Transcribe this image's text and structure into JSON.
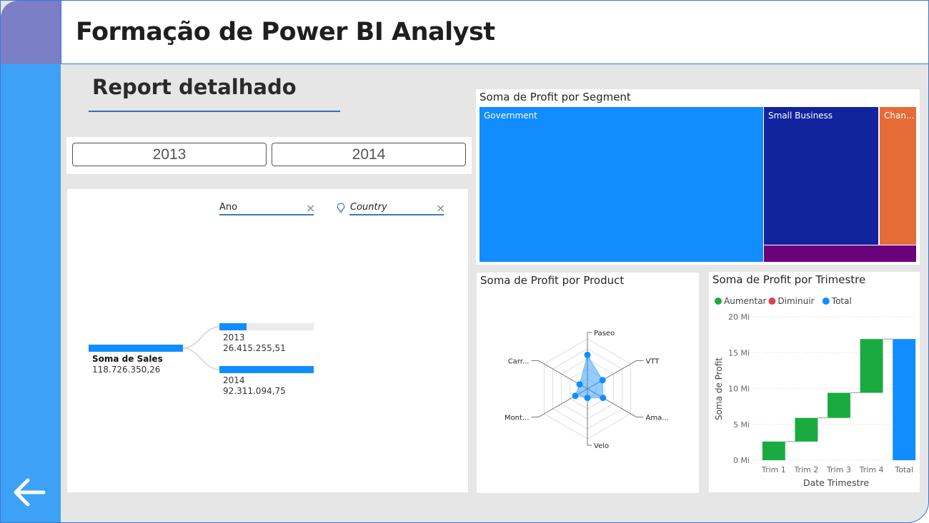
{
  "header": {
    "title": "Formação de Power BI Analyst"
  },
  "page": {
    "subtitle": "Report detalhado"
  },
  "slicer": {
    "years": [
      "2013",
      "2014"
    ]
  },
  "decomposition": {
    "filter_ano": "Ano",
    "filter_country": "Country",
    "root_label": "Soma de Sales",
    "root_value": "118.726.350,26",
    "nodes": [
      {
        "label": "2013",
        "value": "26.415.255,51",
        "fill": 0.29
      },
      {
        "label": "2014",
        "value": "92.311.094,75",
        "fill": 1.0
      }
    ]
  },
  "treemap": {
    "title": "Soma de Profit por Segment",
    "items": [
      {
        "label": "Government",
        "color": "#118dff"
      },
      {
        "label": "Small Business",
        "color": "#12239e"
      },
      {
        "label": "Chan...",
        "color": "#e66c37"
      },
      {
        "label": "",
        "color": "#6b007b"
      }
    ]
  },
  "chart_data": [
    {
      "type": "radar",
      "title": "Soma de Profit por Product",
      "categories": [
        "Paseo",
        "VTT",
        "Ama...",
        "Velo",
        "Mont...",
        "Carr..."
      ],
      "values": [
        0.68,
        0.35,
        0.36,
        0.18,
        0.28,
        0.18
      ]
    },
    {
      "type": "waterfall",
      "title": "Soma de Profit por Trimestre",
      "legend": [
        "Aumentar",
        "Diminuir",
        "Total"
      ],
      "legend_colors": [
        "#1aab40",
        "#d64550",
        "#118dff"
      ],
      "categories": [
        "Trim 1",
        "Trim 2",
        "Trim 3",
        "Trim 4",
        "Total"
      ],
      "values": [
        2.6,
        3.3,
        3.5,
        7.5,
        16.9
      ],
      "xlabel": "Date Trimestre",
      "ylabel": "Soma de Profit",
      "yticks": [
        "0 Mi",
        "5 Mi",
        "10 Mi",
        "15 Mi",
        "20 Mi"
      ],
      "ylim": [
        0,
        20
      ]
    }
  ]
}
